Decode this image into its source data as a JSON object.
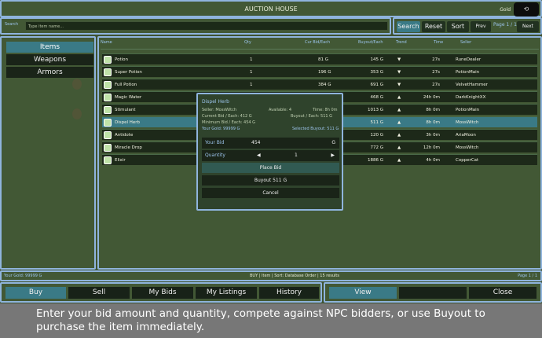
{
  "window": {
    "title": "AUCTION HOUSE",
    "gold_label": "Gold",
    "gold_button": "⟲"
  },
  "search": {
    "label": "Search",
    "placeholder": "Type item name..."
  },
  "controls": {
    "search": "Search",
    "reset": "Reset",
    "sort": "Sort",
    "prev": "Prev",
    "page": "Page 1 / 1",
    "next": "Next"
  },
  "categories": [
    "Items",
    "Weapons",
    "Armors"
  ],
  "columns": {
    "name": "Name",
    "qty": "Qty",
    "current": "Cur Bid/Each",
    "buyout": "Buyout/Each",
    "trend": "Trend",
    "time": "Time",
    "seller": "Seller"
  },
  "rows": [
    {
      "name": "Potion",
      "qty": "1",
      "bid": "81 G",
      "buyout": "145 G",
      "trend": "▼",
      "time": "27s",
      "seller": "RuneDealer"
    },
    {
      "name": "Super Potion",
      "qty": "1",
      "bid": "196 G",
      "buyout": "353 G",
      "trend": "▼",
      "time": "27s",
      "seller": "PotionMain"
    },
    {
      "name": "Full Potion",
      "qty": "1",
      "bid": "384 G",
      "buyout": "691 G",
      "trend": "▼",
      "time": "27s",
      "seller": "VelvetHammer"
    },
    {
      "name": "Magic Water",
      "qty": "",
      "bid": "",
      "buyout": "468 G",
      "trend": "▲",
      "time": "24h 0m",
      "seller": "DarkKnightXX"
    },
    {
      "name": "Stimulant",
      "qty": "",
      "bid": "",
      "buyout": "1013 G",
      "trend": "▲",
      "time": "8h 0m",
      "seller": "PotionMain"
    },
    {
      "name": "Dispel Herb",
      "qty": "",
      "bid": "",
      "buyout": "511 G",
      "trend": "▲",
      "time": "8h 0m",
      "seller": "MossWitch"
    },
    {
      "name": "Antidote",
      "qty": "",
      "bid": "",
      "buyout": "120 G",
      "trend": "▲",
      "time": "3h 0m",
      "seller": "AriaMoon"
    },
    {
      "name": "Miracle Drop",
      "qty": "",
      "bid": "",
      "buyout": "772 G",
      "trend": "▲",
      "time": "12h 0m",
      "seller": "MossWitch"
    },
    {
      "name": "Elixir",
      "qty": "",
      "bid": "",
      "buyout": "1886 G",
      "trend": "▲",
      "time": "4h 0m",
      "seller": "CopperCat"
    }
  ],
  "modal": {
    "item_name": "Dispel Herb",
    "seller": "Seller: MossWitch",
    "available": "Available: 4",
    "time": "Time: 8h 0m",
    "current_bid": "Current Bid / Each: 412 G",
    "buyout_each": "Buyout / Each: 511 G",
    "min_bid": "Minimum Bid / Each: 454 G",
    "your_gold": "Your Gold: 99999 G",
    "selected_buyout": "Selected Buyout: 511 G",
    "your_bid_label": "Your Bid",
    "your_bid_value": "454",
    "your_bid_unit": "G",
    "quantity_label": "Quantity",
    "quantity_value": "1",
    "place_bid": "Place Bid",
    "buyout": "Buyout  511 G",
    "cancel": "Cancel"
  },
  "status": {
    "left": "Your Gold: 99999 G",
    "center": "BUY | Item | Sort: Database Order | 15 results",
    "right": "Page 1 / 1"
  },
  "bottom": {
    "tabs": [
      "Buy",
      "Sell",
      "My Bids",
      "My Listings",
      "History"
    ],
    "view": "View",
    "blank": "",
    "close": "Close"
  },
  "caption": "Enter your bid amount and quantity, compete against NPC bidders, or use Buyout to purchase the item immediately.",
  "colors": {
    "accent": "#3a7a86",
    "border": "#8fb4dd",
    "background": "#3e5230"
  }
}
